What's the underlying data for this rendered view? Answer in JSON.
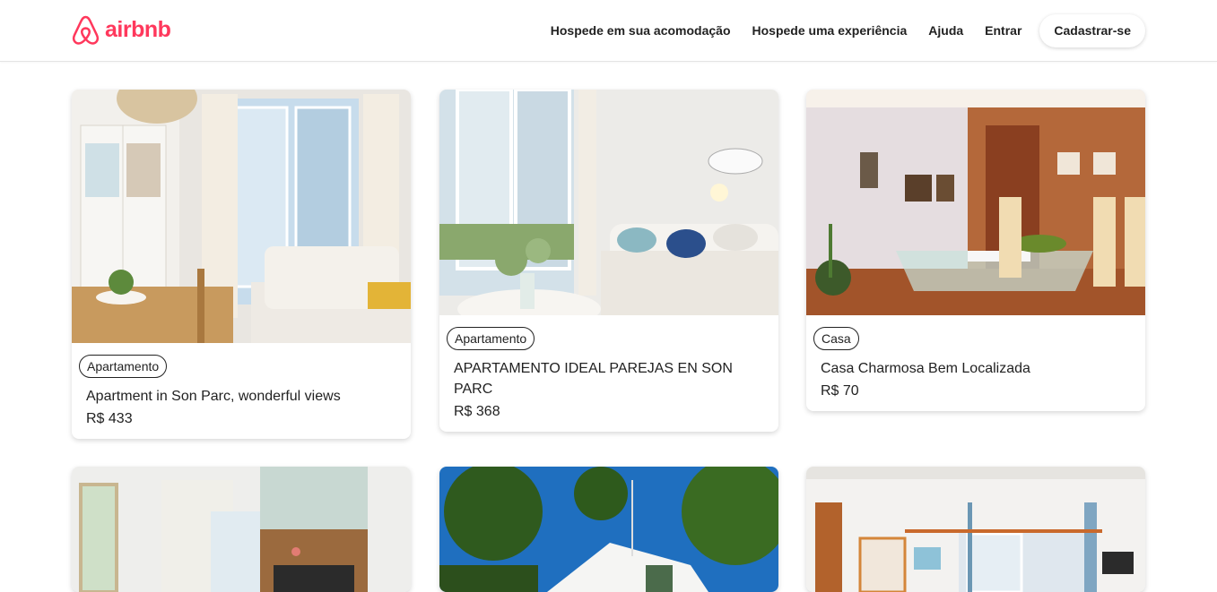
{
  "brand": {
    "name": "airbnb",
    "color": "#ff385c",
    "icon": "airbnb-belo-icon"
  },
  "nav": {
    "host_home": "Hospede em sua acomodação",
    "host_experience": "Hospede uma experiência",
    "help": "Ajuda",
    "login": "Entrar",
    "signup": "Cadastrar-se"
  },
  "listings": [
    {
      "type": "Apartamento",
      "title": "Apartment in Son Parc, wonderful views",
      "price": "R$ 433"
    },
    {
      "type": "Apartamento",
      "title": "APARTAMENTO IDEAL PAREJAS EN SON PARC",
      "price": "R$ 368"
    },
    {
      "type": "Casa",
      "title": "Casa Charmosa Bem Localizada",
      "price": "R$ 70"
    },
    {
      "type": "",
      "title": "",
      "price": ""
    },
    {
      "type": "",
      "title": "",
      "price": ""
    },
    {
      "type": "",
      "title": "",
      "price": ""
    }
  ]
}
